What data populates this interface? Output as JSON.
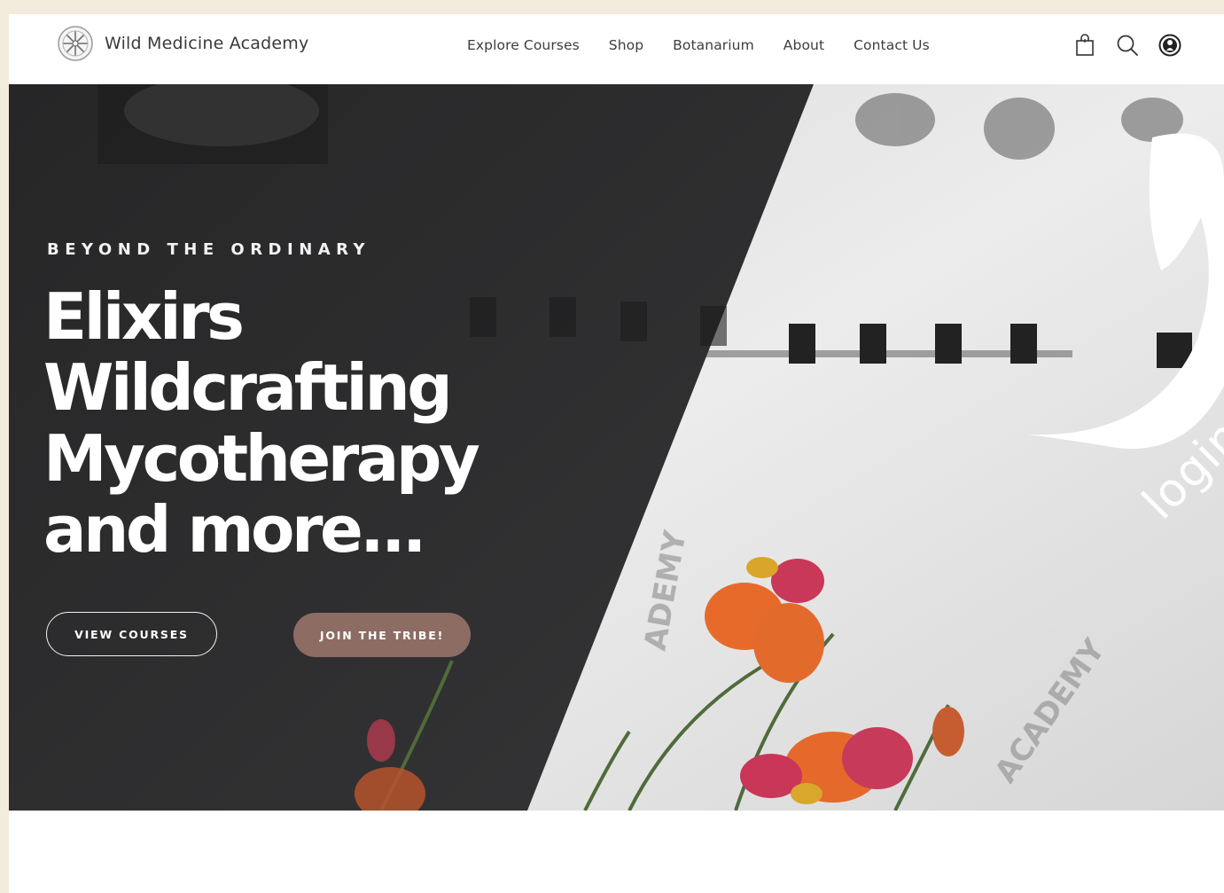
{
  "brand": {
    "name": "Wild Medicine Academy",
    "logo_icon": "compass-flower-logo-icon"
  },
  "nav": {
    "items": [
      {
        "label": "Explore Courses"
      },
      {
        "label": "Shop"
      },
      {
        "label": "Botanarium"
      },
      {
        "label": "About"
      },
      {
        "label": "Contact Us"
      }
    ]
  },
  "header_icons": {
    "cart": "shopping-bag-icon",
    "search": "search-icon",
    "account": "user-account-icon"
  },
  "hero": {
    "eyebrow": "BEYOND THE ORDINARY",
    "headline_lines": [
      "Elixirs",
      "Wildcrafting",
      "Mycotherapy",
      "and more..."
    ],
    "primary_button": "VIEW COURSES",
    "secondary_button": "JOIN THE TRIBE!",
    "login_callout": "login"
  },
  "colors": {
    "page_bg": "#f3ecdc",
    "hero_dark": "#2e2e30",
    "accent_button": "#8c6c63",
    "text_dark": "#3d3d3d"
  }
}
